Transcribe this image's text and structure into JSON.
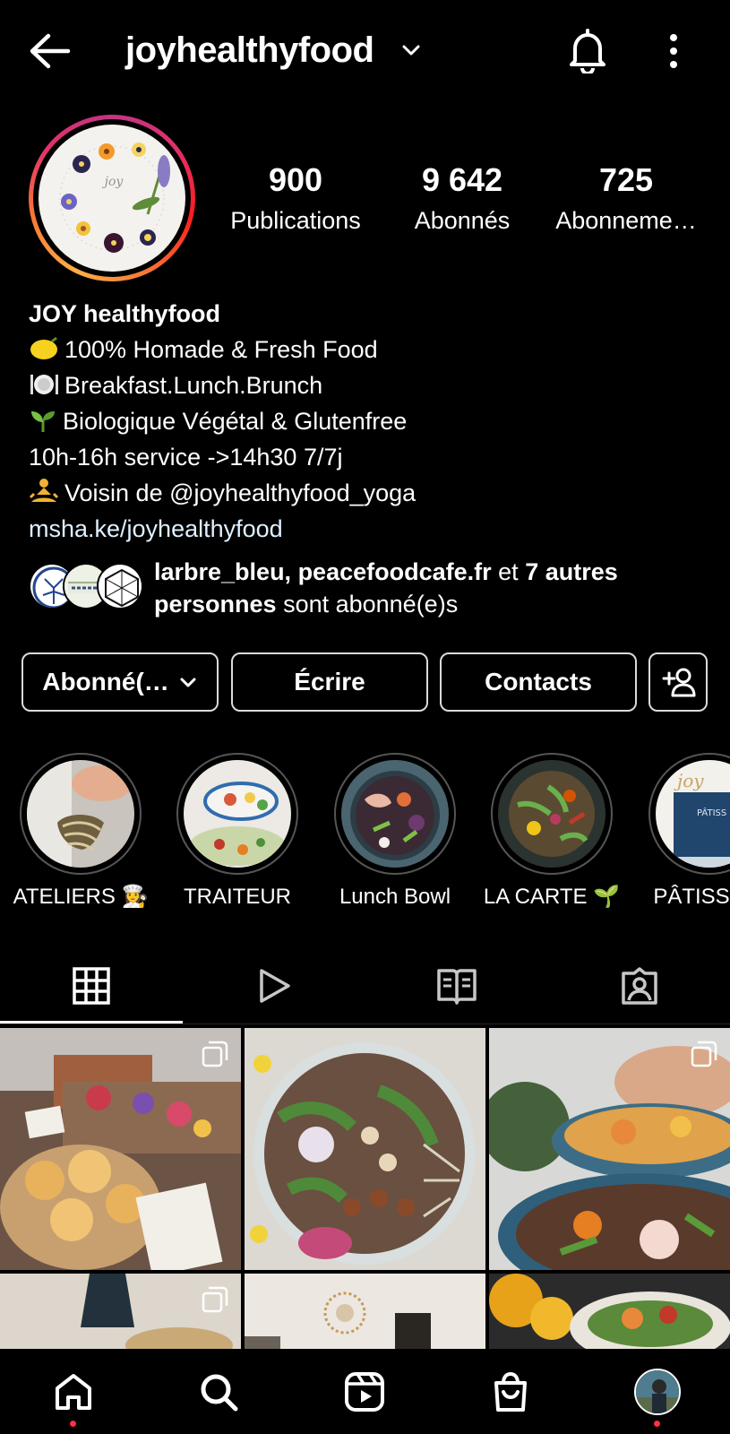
{
  "header": {
    "username": "joyhealthyfood"
  },
  "profile": {
    "stats": [
      {
        "value": "900",
        "label": "Publications"
      },
      {
        "value": "9 642",
        "label": "Abonnés"
      },
      {
        "value": "725",
        "label": "Abonneme…"
      }
    ],
    "display_name": "JOY healthyfood",
    "bio_lines": [
      "100% Homade & Fresh Food",
      "Breakfast.Lunch.Brunch",
      "Biologique Végétal & Glutenfree",
      "10h-16h service ->14h30 7/7j",
      "Voisin de @joyhealthyfood_yoga"
    ],
    "link": "msha.ke/joyhealthyfood",
    "followed_by": {
      "names": "larbre_bleu, peacefoodcafe.fr",
      "connector": "et",
      "others": "7 autres personnes",
      "suffix": "sont abonné(e)s"
    }
  },
  "actions": {
    "following_label": "Abonné(…",
    "message_label": "Écrire",
    "contacts_label": "Contacts"
  },
  "highlights": [
    {
      "label": "ATELIERS 👩‍🍳"
    },
    {
      "label": "TRAITEUR"
    },
    {
      "label": "Lunch Bowl"
    },
    {
      "label": "LA CARTE 🌱"
    },
    {
      "label": "PÂTISSERI"
    }
  ],
  "highlight_text": {
    "joy": "joy",
    "patis": "PÂTISS"
  },
  "tabs": [
    "grid",
    "reels",
    "guides",
    "tagged"
  ],
  "colors": {
    "background": "#000000",
    "text": "#ffffff",
    "border": "#dbdbdb",
    "story_ring": [
      "#c13584",
      "#e1306c",
      "#fd1d1d",
      "#f77737",
      "#fcaf45"
    ],
    "notification_dot": "#ff3040"
  },
  "icons": {
    "back": "arrow-left-icon",
    "dropdown": "chevron-down-icon",
    "bell": "bell-icon",
    "more": "more-vertical-icon",
    "add_user": "add-user-icon",
    "grid": "grid-icon",
    "reels": "reels-icon",
    "guides": "guides-icon",
    "tagged": "tagged-icon",
    "home": "home-icon",
    "search": "search-icon",
    "reels_nav": "reels-nav-icon",
    "shop": "shop-icon",
    "profile": "profile-avatar-icon"
  }
}
